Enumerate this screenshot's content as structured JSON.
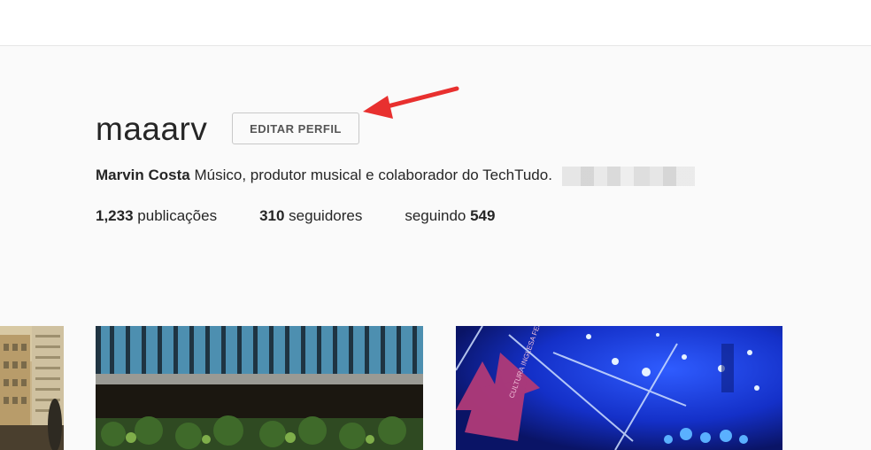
{
  "profile": {
    "username": "maaarv",
    "edit_button_label": "EDITAR PERFIL",
    "full_name": "Marvin Costa",
    "bio": "Músico, produtor musical e colaborador do TechTudo."
  },
  "stats": {
    "posts_count": "1,233",
    "posts_label": "publicações",
    "followers_count": "310",
    "followers_label": "seguidores",
    "following_label": "seguindo",
    "following_count": "549"
  },
  "photo3": {
    "sign_text": "CULTURA INGLESA FESTIVAL"
  },
  "colors": {
    "arrow": "#e8302f",
    "background": "#fafafa",
    "text": "#262626"
  }
}
